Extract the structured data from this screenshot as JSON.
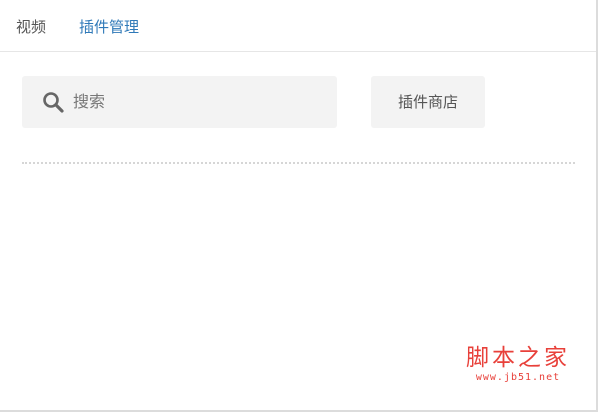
{
  "tabs": [
    {
      "label": "视频",
      "active": false
    },
    {
      "label": "插件管理",
      "active": true
    }
  ],
  "search": {
    "placeholder": "搜索",
    "icon": "search-icon"
  },
  "toolbar": {
    "store_label": "插件商店"
  },
  "watermark": {
    "main": "脚本之家",
    "url": "www.jb51.net"
  },
  "colors": {
    "active_tab": "#2f79b8",
    "inactive_tab": "#555555",
    "control_bg": "#f3f3f3",
    "watermark": "#e8403a"
  }
}
